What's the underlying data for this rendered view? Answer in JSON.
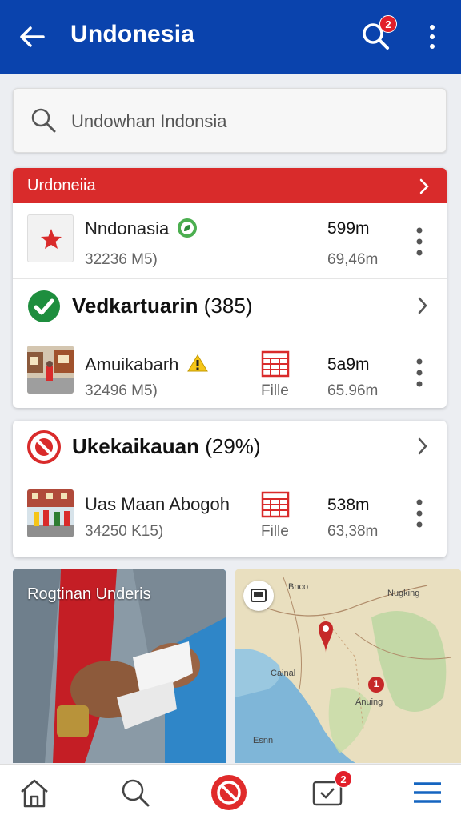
{
  "appbar": {
    "title": "Undonesia",
    "search_badge": "2"
  },
  "search": {
    "placeholder": "Undowhan Indonsia"
  },
  "card1": {
    "header_label": "Urdoneiia",
    "row1": {
      "title": "Nndonasia",
      "subtitle": "32236 M5)",
      "value": "599m",
      "value2": "69,46m"
    },
    "section": {
      "title": "Vedkartuarin",
      "count": "(385)"
    },
    "row2": {
      "title": "Amuikabarh",
      "subtitle": "32496 M5)",
      "file_label": "Fille",
      "value": "5a9m",
      "value2": "65.96m"
    }
  },
  "card2": {
    "section": {
      "title": "Ukekaikauan",
      "count": "(29%)"
    },
    "row": {
      "title": "Uas Maan Abogoh",
      "subtitle": "34250 K15)",
      "file_label": "Fille",
      "value": "538m",
      "value2": "63,38m"
    }
  },
  "tiles": {
    "photo_caption": "Rogtinan Underis",
    "map_labels": {
      "top": "Bnco",
      "right": "Nugking",
      "center": "Cainal",
      "lower": "Anuing",
      "bottom": "Esnn",
      "pin_number": "1"
    }
  },
  "bottom_nav": {
    "badge": "2"
  },
  "colors": {
    "appbar": "#0a43ad",
    "header_red": "#d92b2b",
    "badge": "#e21f2a"
  }
}
